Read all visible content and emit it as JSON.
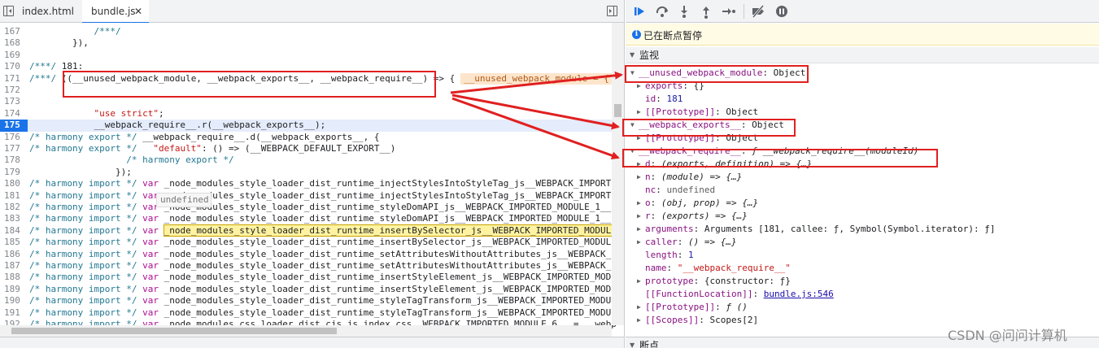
{
  "editor": {
    "tabs": [
      {
        "label": "index.html"
      },
      {
        "label": "bundle.js",
        "close": "✕"
      }
    ],
    "tooltip": "undefined",
    "lines": [
      {
        "num": "167",
        "code": "            /***/"
      },
      {
        "num": "168",
        "code": "        }),"
      },
      {
        "num": "169",
        "code": ""
      },
      {
        "num": "170",
        "code": "/***/ 181:"
      },
      {
        "num": "171",
        "code": "/***/ ((__unused_webpack_module, __webpack_exports__, __webpack_require__) => {"
      },
      {
        "num": "172",
        "code": ""
      },
      {
        "num": "173",
        "code": ""
      },
      {
        "num": "174",
        "code": "            \"use strict\";"
      },
      {
        "num": "175",
        "code": "            __webpack_require__.r(__webpack_exports__);"
      },
      {
        "num": "176",
        "code": "/* harmony export */ __webpack_require__.d(__webpack_exports__, {"
      },
      {
        "num": "177",
        "code": "/* harmony export */   \"default\": () => (__WEBPACK_DEFAULT_EXPORT__)"
      },
      {
        "num": "178",
        "code": "                  /* harmony export */"
      },
      {
        "num": "179",
        "code": "                });"
      },
      {
        "num": "180",
        "code": "/* harmony import */ var _node_modules_style_loader_dist_runtime_injectStylesIntoStyleTag_js__WEBPACK_IMPORTED"
      },
      {
        "num": "181",
        "code": "/* harmony import */ var _node_modules_style_loader_dist_runtime_injectStylesIntoStyleTag_js__WEBPACK_IMPORTED"
      },
      {
        "num": "182",
        "code": "/* harmony import */ var _node_modules_style_loader_dist_runtime_styleDomAPI_js__WEBPACK_IMPORTED_MODULE_1__"
      },
      {
        "num": "183",
        "code": "/* harmony import */ var _node_modules_style_loader_dist_runtime_styleDomAPI_js__WEBPACK_IMPORTED_MODULE_1__"
      },
      {
        "num": "184",
        "code": "/* harmony import */ var _node_modules_style_loader_dist_runtime_insertBySelector_js__WEBPACK_IMPORTED_MODULE"
      },
      {
        "num": "185",
        "code": "/* harmony import */ var _node_modules_style_loader_dist_runtime_insertBySelector_js__WEBPACK_IMPORTED_MODULE"
      },
      {
        "num": "186",
        "code": "/* harmony import */ var _node_modules_style_loader_dist_runtime_setAttributesWithoutAttributes_js__WEBPACK_I"
      },
      {
        "num": "187",
        "code": "/* harmony import */ var _node_modules_style_loader_dist_runtime_setAttributesWithoutAttributes_js__WEBPACK_I"
      },
      {
        "num": "188",
        "code": "/* harmony import */ var _node_modules_style_loader_dist_runtime_insertStyleElement_js__WEBPACK_IMPORTED_MODU"
      },
      {
        "num": "189",
        "code": "/* harmony import */ var _node_modules_style_loader_dist_runtime_insertStyleElement_js__WEBPACK_IMPORTED_MODU"
      },
      {
        "num": "190",
        "code": "/* harmony import */ var _node_modules_style_loader_dist_runtime_styleTagTransform_js__WEBPACK_IMPORTED_MODULE"
      },
      {
        "num": "191",
        "code": "/* harmony import */ var _node_modules_style_loader_dist_runtime_styleTagTransform_js__WEBPACK_IMPORTED_MODULE"
      },
      {
        "num": "192",
        "code": "/* harmony import */ var _node_modules_css_loader_dist_cjs_js_index_css__WEBPACK_IMPORTED_MODULE_6__ = __webp"
      }
    ],
    "current_line": "175",
    "inline_value": "__unused_webpack_module = {"
  },
  "debugger": {
    "paused_text": "已在断点暂停",
    "paused_icon": "i",
    "watch_label": "监视",
    "breakpoints_label": "断点",
    "toolbar_icons": [
      "resume-icon",
      "step-over-icon",
      "step-into-icon",
      "step-out-icon",
      "step-icon",
      "deactivate-breakpoints-icon",
      "pause-on-exceptions-icon"
    ],
    "watch_rows": [
      {
        "indent": 0,
        "arrow": "▼",
        "name": "__unused_webpack_module",
        "sep": ": ",
        "value": "Object",
        "kind": "hdr"
      },
      {
        "indent": 1,
        "arrow": "▶",
        "name": "exports",
        "sep": ": ",
        "value": "{}",
        "kind": "obj"
      },
      {
        "indent": 1,
        "arrow": "",
        "name": "id",
        "sep": ": ",
        "value": "181",
        "kind": "num"
      },
      {
        "indent": 1,
        "arrow": "▶",
        "name": "[[Prototype]]",
        "sep": ": ",
        "value": "Object",
        "kind": "obj"
      },
      {
        "indent": 0,
        "arrow": "▼",
        "name": "__webpack_exports__",
        "sep": ": ",
        "value": "Object",
        "kind": "hdr"
      },
      {
        "indent": 1,
        "arrow": "▶",
        "name": "[[Prototype]]",
        "sep": ": ",
        "value": "Object",
        "kind": "obj"
      },
      {
        "indent": 0,
        "arrow": "▼",
        "name": "__webpack_require__",
        "sep": ": ",
        "value": "ƒ __webpack_require__(moduleId)",
        "kind": "fn"
      },
      {
        "indent": 1,
        "arrow": "▶",
        "name": "d",
        "sep": ": ",
        "value": "(exports, definition) => {…}",
        "kind": "fn"
      },
      {
        "indent": 1,
        "arrow": "▶",
        "name": "n",
        "sep": ": ",
        "value": "(module) => {…}",
        "kind": "fn"
      },
      {
        "indent": 1,
        "arrow": "",
        "name": "nc",
        "sep": ": ",
        "value": "undefined",
        "kind": "dim"
      },
      {
        "indent": 1,
        "arrow": "▶",
        "name": "o",
        "sep": ": ",
        "value": "(obj, prop) => {…}",
        "kind": "fn"
      },
      {
        "indent": 1,
        "arrow": "▶",
        "name": "r",
        "sep": ": ",
        "value": "(exports) => {…}",
        "kind": "fn"
      },
      {
        "indent": 1,
        "arrow": "▶",
        "name": "arguments",
        "sep": ": ",
        "value": "Arguments [181, callee: ƒ, Symbol(Symbol.iterator): ƒ]",
        "kind": "obj"
      },
      {
        "indent": 1,
        "arrow": "▶",
        "name": "caller",
        "sep": ": ",
        "value": "() => {…}",
        "kind": "fn"
      },
      {
        "indent": 1,
        "arrow": "",
        "name": "length",
        "sep": ": ",
        "value": "1",
        "kind": "num"
      },
      {
        "indent": 1,
        "arrow": "",
        "name": "name",
        "sep": ": ",
        "value": "\"__webpack_require__\"",
        "kind": "str"
      },
      {
        "indent": 1,
        "arrow": "▶",
        "name": "prototype",
        "sep": ": ",
        "value": "{constructor: ƒ}",
        "kind": "obj"
      },
      {
        "indent": 1,
        "arrow": "",
        "name": "[[FunctionLocation]]",
        "sep": ": ",
        "value": "bundle.js:546",
        "kind": "link"
      },
      {
        "indent": 1,
        "arrow": "▶",
        "name": "[[Prototype]]",
        "sep": ": ",
        "value": "ƒ ()",
        "kind": "fn"
      },
      {
        "indent": 1,
        "arrow": "▶",
        "name": "[[Scopes]]",
        "sep": ": ",
        "value": "Scopes[2]",
        "kind": "obj"
      }
    ]
  },
  "watermark": "CSDN @问问计算机",
  "colors": {
    "accent": "#1a73e8",
    "annotation": "#e02020",
    "paused_bg": "#fffbe5"
  }
}
